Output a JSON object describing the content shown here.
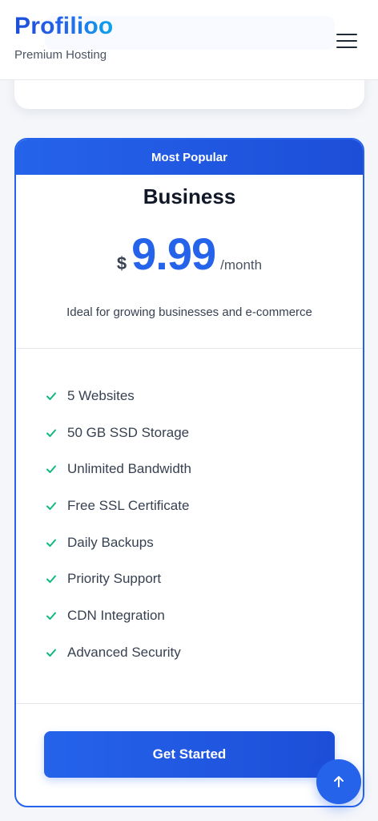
{
  "header": {
    "brand": "Profilioo",
    "tagline": "Premium Hosting",
    "menu_icon": "hamburger-menu-icon"
  },
  "plan": {
    "badge": "Most Popular",
    "name": "Business",
    "currency": "$",
    "price": "9.99",
    "period": "/month",
    "description": "Ideal for growing businesses and e-commerce",
    "features": [
      "5 Websites",
      "50 GB SSD Storage",
      "Unlimited Bandwidth",
      "Free SSL Certificate",
      "Daily Backups",
      "Priority Support",
      "CDN Integration",
      "Advanced Security"
    ],
    "feature_icon": "check-icon",
    "cta_label": "Get Started"
  },
  "scroll_top_icon": "arrow-up-icon",
  "colors": {
    "accent": "#2563eb",
    "check": "#10b981"
  }
}
